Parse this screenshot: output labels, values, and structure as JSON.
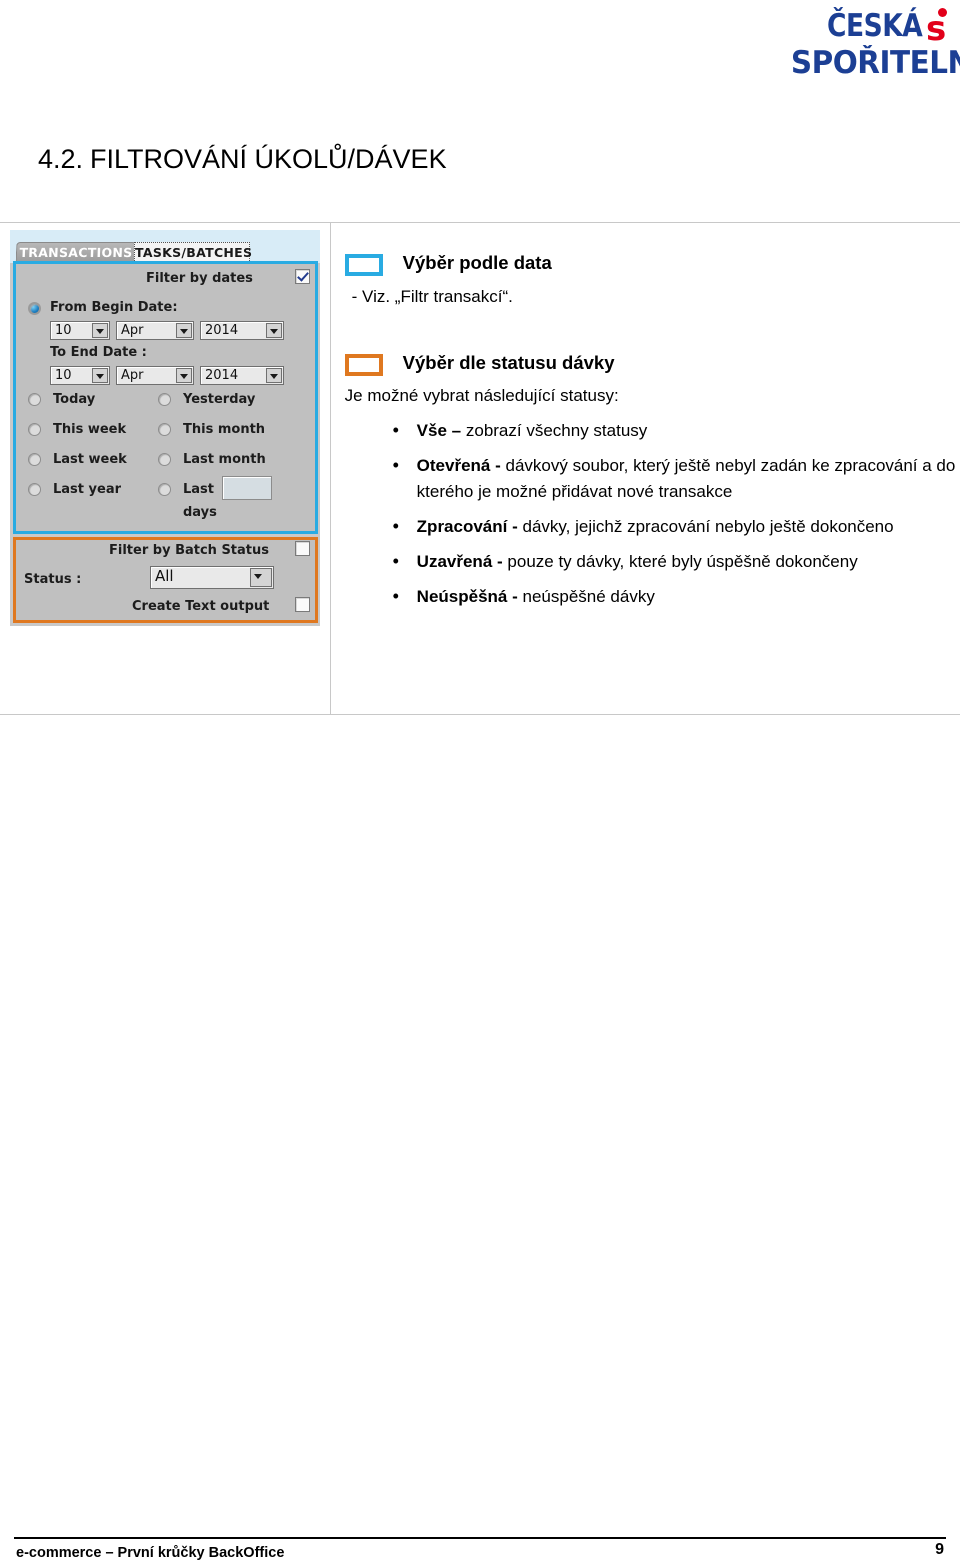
{
  "logo": {
    "line1": "ČESKÁ",
    "line2": "SPOŘITELNA",
    "mark": "s",
    "brand_blue": "#1C3F94",
    "brand_red": "#E2001A"
  },
  "heading": {
    "number": "4.2.",
    "text": "FILTROVÁNÍ ÚKOLŮ/DÁVEK"
  },
  "screenshot": {
    "tabs": [
      {
        "label": "TRANSACTIONS",
        "active": false
      },
      {
        "label": "TASKS/BATCHES",
        "active": true
      }
    ],
    "dates_group": {
      "accent_color": "#29ABE2",
      "filter_by_dates_label": "Filter by dates",
      "filter_by_dates_checked": true,
      "from_begin_label": "From Begin Date:",
      "from_begin_selected": true,
      "from_day": "10",
      "from_month": "Apr",
      "from_year": "2014",
      "to_end_label": "To End Date :",
      "to_day": "10",
      "to_month": "Apr",
      "to_year": "2014",
      "presets": [
        {
          "label": "Today",
          "selected": false
        },
        {
          "label": "Yesterday",
          "selected": false
        },
        {
          "label": "This week",
          "selected": false
        },
        {
          "label": "This month",
          "selected": false
        },
        {
          "label": "Last week",
          "selected": false
        },
        {
          "label": "Last month",
          "selected": false
        },
        {
          "label": "Last year",
          "selected": false
        },
        {
          "label": "Last",
          "selected": false
        }
      ],
      "last_days_value": "",
      "days_label": "days"
    },
    "status_group": {
      "accent_color": "#DF7820",
      "filter_by_batch_status_label": "Filter by Batch Status",
      "filter_by_batch_status_checked": false,
      "status_label": "Status :",
      "status_value": "All",
      "create_text_output_label": "Create Text output",
      "create_text_output_checked": false
    }
  },
  "content": {
    "legend_date": {
      "title": "Výběr podle data",
      "note": "- Viz. „Filtr transakcí“."
    },
    "legend_status": {
      "title": "Výběr dle statusu dávky",
      "intro": "Je možné vybrat následující statusy:"
    },
    "statuses": [
      {
        "name": "Vše",
        "sep": "–",
        "desc": "zobrazí všechny statusy"
      },
      {
        "name": "Otevřená",
        "sep": "-",
        "desc": "dávkový soubor, který ještě nebyl zadán ke zpracování a do kterého je možné přidávat nové transakce"
      },
      {
        "name": "Zpracování",
        "sep": "-",
        "desc": "dávky, jejichž zpracování nebylo ještě dokončeno"
      },
      {
        "name": "Uzavřená",
        "sep": "-",
        "desc": "pouze ty dávky, které byly úspěšně dokončeny"
      },
      {
        "name": "Neúspěšná",
        "sep": "-",
        "desc": "neúspěšné dávky"
      }
    ]
  },
  "footer": {
    "left": "e-commerce – První krůčky BackOffice",
    "page": "9"
  }
}
